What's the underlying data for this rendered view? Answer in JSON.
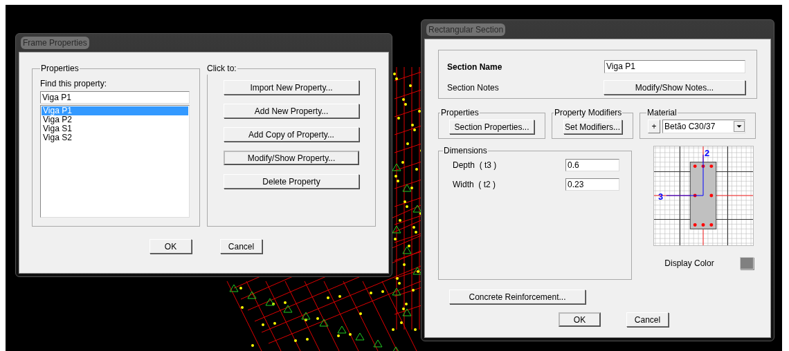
{
  "frame_properties": {
    "title": "Frame Properties",
    "properties": {
      "label": "Properties",
      "find_label": "Find this property:",
      "find_value": "Viga P1",
      "items": [
        {
          "label": "Viga P1",
          "selected": true
        },
        {
          "label": "Viga P2",
          "selected": false
        },
        {
          "label": "Viga S1",
          "selected": false
        },
        {
          "label": "Viga S2",
          "selected": false
        }
      ]
    },
    "click_to": {
      "label": "Click to:",
      "buttons": [
        {
          "label": "Import New Property...",
          "default": false
        },
        {
          "label": "Add New Property...",
          "default": false
        },
        {
          "label": "Add Copy of Property...",
          "default": false
        },
        {
          "label": "Modify/Show Property...",
          "default": true
        },
        {
          "label": "Delete Property",
          "default": false
        }
      ]
    },
    "footer_buttons": [
      {
        "label": "OK",
        "default": false
      },
      {
        "label": "Cancel",
        "default": false
      }
    ]
  },
  "rectangular_section": {
    "title": "Rectangular Section",
    "section_name_label": "Section Name",
    "section_name": "Viga P1",
    "section_notes_label": "Section Notes",
    "notes_button": "Modify/Show Notes...",
    "properties": {
      "label": "Properties",
      "button": "Section Properties..."
    },
    "property_modifiers": {
      "label": "Property Modifiers",
      "button": "Set Modifiers..."
    },
    "material": {
      "label": "Material",
      "plus": "+",
      "value": "Betão C30/37"
    },
    "dimensions": {
      "label": "Dimensions",
      "fields": [
        {
          "label": "Depth  ( t3 )",
          "value": "0.6"
        },
        {
          "label": "Width  ( t2 )",
          "value": "0.23"
        }
      ]
    },
    "preview": {
      "axis_labels": [
        "2",
        "3"
      ]
    },
    "display_color_label": "Display Color",
    "reinforcement_button": "Concrete Reinforcement...",
    "footer_buttons": [
      {
        "label": "OK",
        "default": true
      },
      {
        "label": "Cancel",
        "default": false
      }
    ]
  }
}
